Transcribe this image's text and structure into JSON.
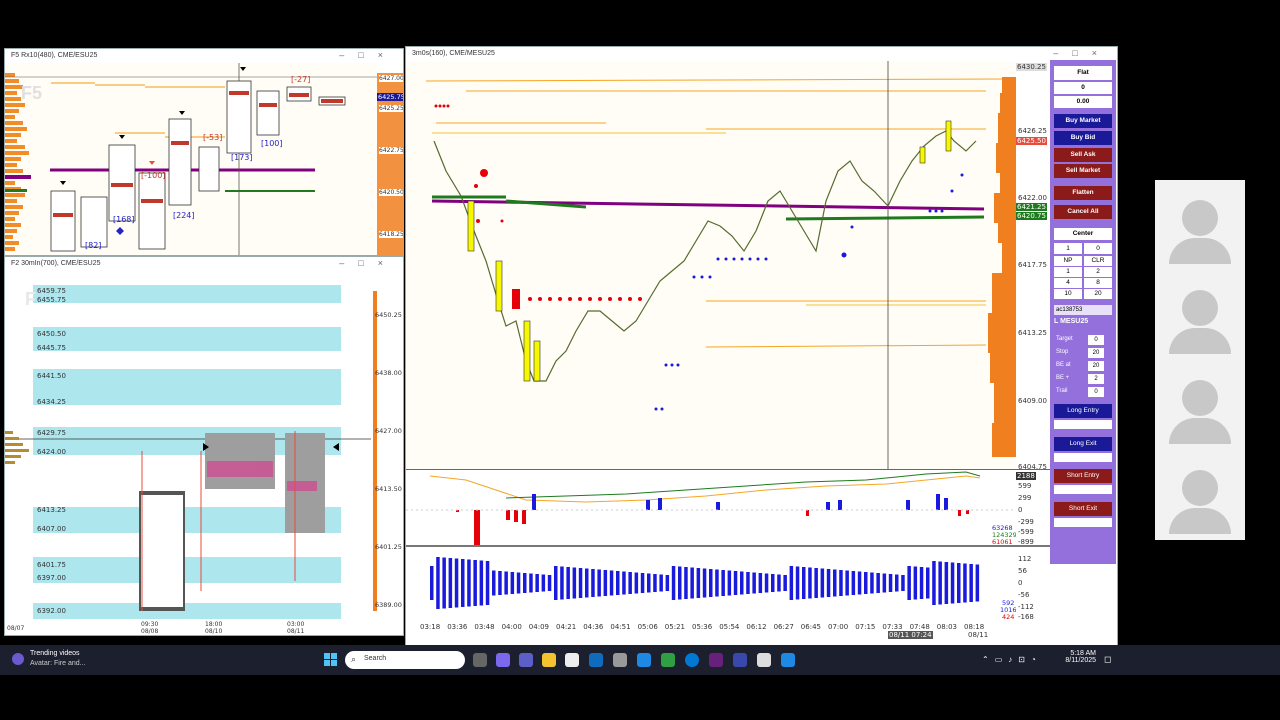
{
  "windows": {
    "f5": {
      "title": "F5 Rx10(480), CME/ESU25",
      "watermark": "F5",
      "y_labels": [
        "6427.00",
        "6425.25",
        "6422.75",
        "6420.50",
        "6418.25"
      ],
      "current_price": "6425.75",
      "profile_labels": [
        "[-27]",
        "[-53]",
        "[-100]",
        "[173]",
        "[100]",
        "[168]",
        "[224]",
        "[82]"
      ]
    },
    "f2": {
      "title": "F2 30mIn(700), CME/ESU25",
      "watermark": "F",
      "price_labels": [
        "6459.75",
        "6455.75",
        "6450.50",
        "6445.75",
        "6441.50",
        "6434.25",
        "6429.75",
        "6424.00",
        "6413.25",
        "6407.00",
        "6401.75",
        "6397.00",
        "6392.00"
      ],
      "right_axis": [
        "6450.25",
        "6438.00",
        "6427.00",
        "6413.50",
        "6401.25",
        "6389.00"
      ],
      "x_labels": [
        "08/07",
        "09:30\n08/08",
        "18:00\n08/10",
        "03:00\n08/11"
      ]
    },
    "main": {
      "title": "3m0s(160), CME/MESU25",
      "y_labels": [
        "6426.25",
        "6422.00",
        "6417.75",
        "6413.25",
        "6409.00",
        "6404.75"
      ],
      "top_price": "6430.25",
      "price_tags": [
        {
          "text": "6425.50",
          "color": "#e84c3d"
        },
        {
          "text": "6421.25",
          "color": "#1f7a1f"
        },
        {
          "text": "6420.75",
          "color": "#1f7a1f"
        }
      ],
      "indicator_labels": [
        "2188",
        "599",
        "299",
        "0",
        "-299",
        "-599",
        "-899"
      ],
      "indicator_values": [
        "63268",
        "124329",
        "61061"
      ],
      "histogram_labels": [
        "112",
        "56",
        "0",
        "-56",
        "-112",
        "-168"
      ],
      "histogram_values": [
        "592",
        "1016",
        "424"
      ],
      "x_labels": [
        "03:18",
        "03:36",
        "03:48",
        "04:00",
        "04:09",
        "04:21",
        "04:36",
        "04:51",
        "05:06",
        "05:21",
        "05:36",
        "05:54",
        "06:12",
        "06:27",
        "06:45",
        "07:00",
        "07:15",
        "07:33",
        "07:48",
        "08:03",
        "08:18"
      ],
      "x_sub": "08/11",
      "crosshair_date": "08/11 07:24"
    }
  },
  "order_panel": {
    "position": "Flat",
    "qty": "0",
    "pnl": "0.00",
    "buy_market": "Buy Market",
    "buy_bid": "Buy Bid",
    "sell_ask": "Sell Ask",
    "sell_market": "Sell Market",
    "flatten": "Flatten",
    "cancel_all": "Cancel All",
    "center": "Center",
    "qty_row": [
      "1",
      "0"
    ],
    "np": "NP",
    "clr": "CLR",
    "grid": [
      "1",
      "2",
      "4",
      "8",
      "10",
      "20"
    ],
    "account": "ac138753",
    "symbol": "L MESU25",
    "fields": [
      {
        "label": "Target",
        "value": "0"
      },
      {
        "label": "Stop",
        "value": "20"
      },
      {
        "label": "BE at",
        "value": "20"
      },
      {
        "label": "BE +",
        "value": "2"
      },
      {
        "label": "Trail",
        "value": "0"
      }
    ],
    "long_entry": "Long Entry",
    "long_exit": "Long Exit",
    "short_entry": "Short Entry",
    "short_exit": "Short Exit"
  },
  "taskbar": {
    "news_title": "Trending videos",
    "news_sub": "Avatar: Fire and...",
    "search_placeholder": "Search",
    "time": "5:18 AM",
    "date": "8/11/2025"
  },
  "colors": {
    "accent_panel": "#9370db",
    "dark_blue": "#1a1a99",
    "dark_red": "#8b1a1a",
    "profile_orange": "#f07f1f"
  }
}
